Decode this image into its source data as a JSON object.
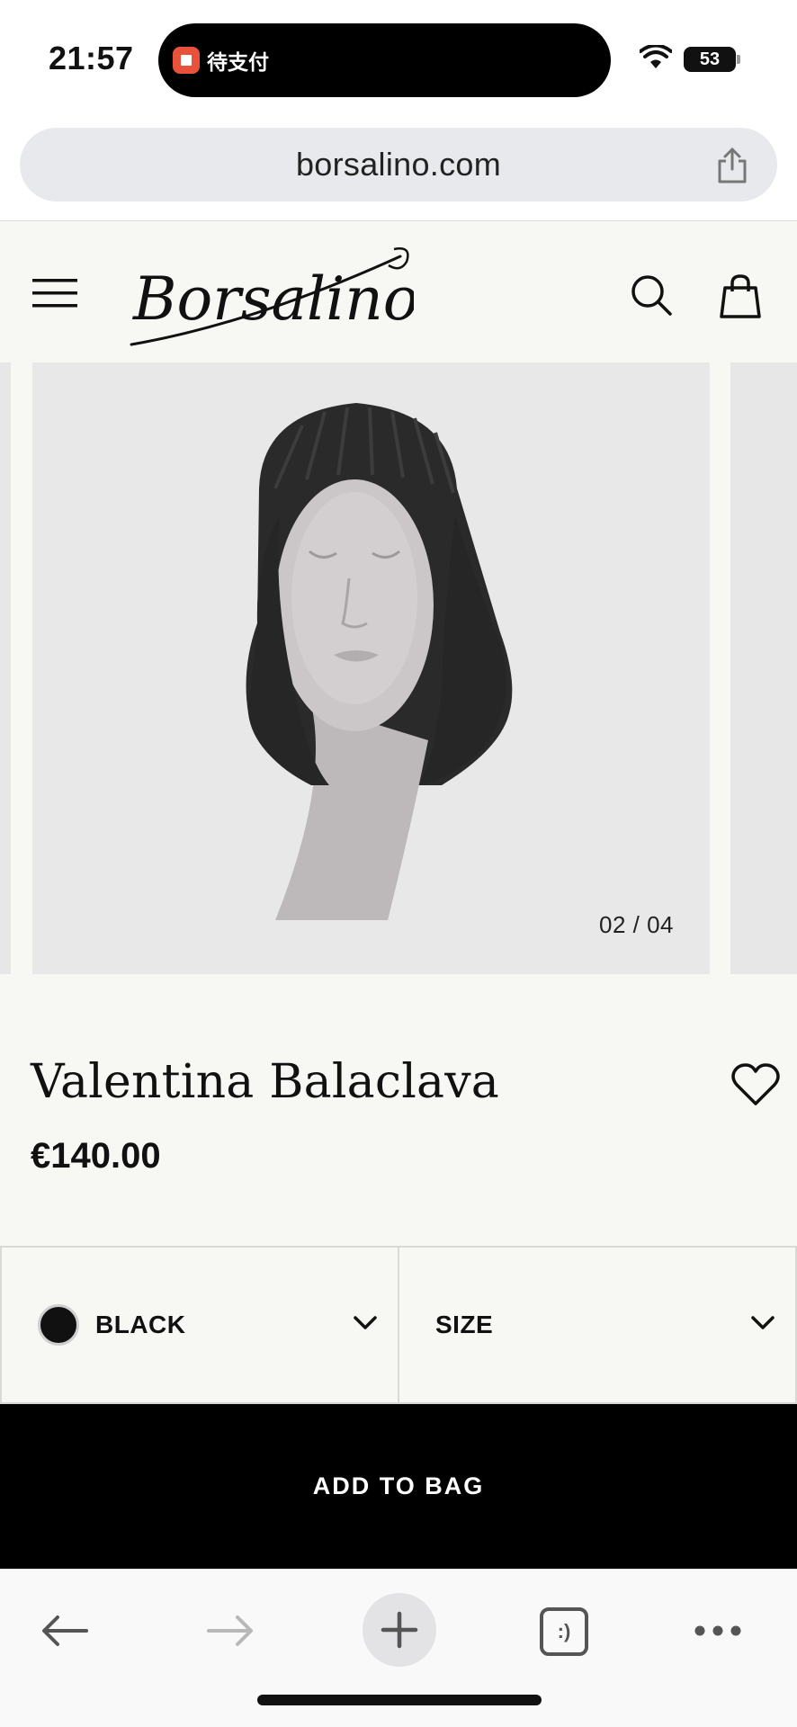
{
  "status_bar": {
    "time": "21:57",
    "activity_text": "待支付",
    "battery_level": "53"
  },
  "browser": {
    "url": "borsalino.com"
  },
  "header": {
    "logo_text": "Borsalino"
  },
  "carousel": {
    "counter": "02 / 04",
    "image_subject": "black ribbed knit balaclava on grey mannequin head"
  },
  "product": {
    "title": "Valentina Balaclava",
    "price": "€140.00"
  },
  "selectors": {
    "color_label": "BLACK",
    "color_hex": "#111111",
    "size_label": "SIZE"
  },
  "actions": {
    "add_to_bag_label": "ADD TO BAG"
  },
  "toolbar": {
    "tabs_label": ":)"
  }
}
